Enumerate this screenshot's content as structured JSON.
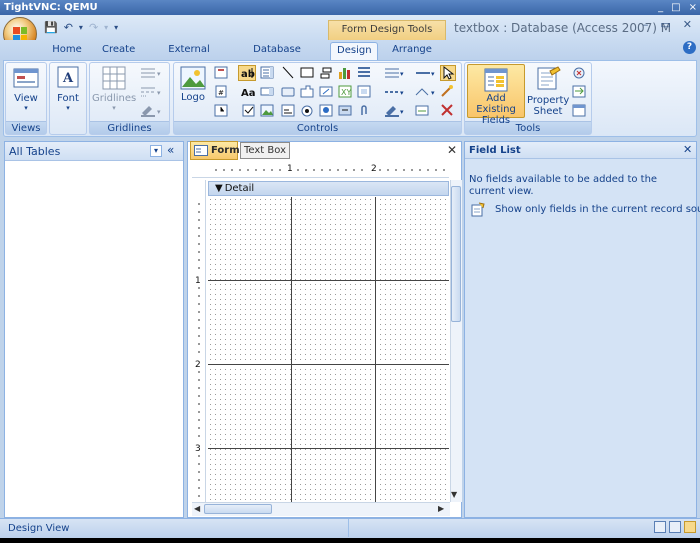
{
  "vnc": {
    "title": "TightVNC: QEMU",
    "controls": [
      "_",
      "□",
      "×"
    ]
  },
  "qat": {
    "save": "💾",
    "undo": "↶",
    "redo": "↷",
    "customize": "▾"
  },
  "window": {
    "contextual": "Form Design Tools",
    "title": "textbox : Database (Access 2007) M",
    "controls": [
      "–",
      "▭",
      "✕"
    ]
  },
  "tabs": [
    {
      "label": "Home"
    },
    {
      "label": "Create"
    },
    {
      "label": "External Data"
    },
    {
      "label": "Database Tools"
    },
    {
      "label": "Design"
    },
    {
      "label": "Arrange"
    }
  ],
  "ribbon": {
    "groups": {
      "views": "Views",
      "gridlines": "Gridlines",
      "controls": "Controls",
      "tools": "Tools"
    },
    "buttons": {
      "view": "View",
      "font": "Font",
      "gridlines": "Gridlines",
      "logo": "Logo",
      "add_existing_fields": "Add Existing Fields",
      "property_sheet": "Property Sheet"
    }
  },
  "nav": {
    "title": "All Tables",
    "dropdown": "▾",
    "collapse": "«"
  },
  "form": {
    "tab": "Form1",
    "tooltip": "Text Box",
    "close": "✕",
    "section": "Detail",
    "ruler_h": [
      "1",
      "2"
    ],
    "ruler_v": [
      "1",
      "2",
      "3"
    ]
  },
  "field_list": {
    "title": "Field List",
    "close": "✕",
    "message": "No fields available to be added to the current view.",
    "link": "Show only fields in the current record source"
  },
  "status": {
    "text": "Design View"
  },
  "colors": {
    "accent": "#15428b",
    "selected": "#f7d98b",
    "office_orange": "#d47b16"
  }
}
